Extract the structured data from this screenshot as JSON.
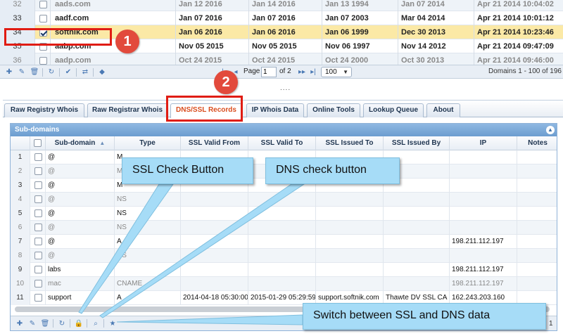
{
  "top_grid": {
    "rows": [
      {
        "num": "32",
        "checked": false,
        "domain": "aads.com",
        "d1": "Jan 12 2016",
        "d2": "Jan 14 2016",
        "d3": "Jan 13 1994",
        "d4": "Jan 07 2014",
        "d5": "Apr 21 2014 10:04:02",
        "style": "faded"
      },
      {
        "num": "33",
        "checked": false,
        "domain": "aadf.com",
        "d1": "Jan 07 2016",
        "d2": "Jan 07 2016",
        "d3": "Jan 07 2003",
        "d4": "Mar 04 2014",
        "d5": "Apr 21 2014 10:01:12",
        "style": "normal"
      },
      {
        "num": "34",
        "checked": true,
        "domain": "softnik.com",
        "d1": "Jan 06 2016",
        "d2": "Jan 06 2016",
        "d3": "Jan 06 1999",
        "d4": "Dec 30 2013",
        "d5": "Apr 21 2014 10:23:46",
        "style": "selected"
      },
      {
        "num": "35",
        "checked": false,
        "domain": "aabp.com",
        "d1": "Nov 05 2015",
        "d2": "Nov 05 2015",
        "d3": "Nov 06 1997",
        "d4": "Nov 14 2012",
        "d5": "Apr 21 2014 09:47:09",
        "style": "normal"
      },
      {
        "num": "36",
        "checked": false,
        "domain": "aadp.com",
        "d1": "Oct 24 2015",
        "d2": "Oct 24 2015",
        "d3": "Oct 24 2000",
        "d4": "Oct 30 2013",
        "d5": "Apr 21 2014 09:46:00",
        "style": "faded"
      }
    ]
  },
  "top_toolbar": {
    "page_label": "Page",
    "page_value": "1",
    "page_of": "of 2",
    "page_size": "100",
    "records": "Domains 1 - 100 of 196"
  },
  "splitter_grip": "....",
  "tabs": [
    {
      "label": "Raw Registry Whois",
      "active": false
    },
    {
      "label": "Raw Registrar Whois",
      "active": false
    },
    {
      "label": "DNS/SSL Records",
      "active": true
    },
    {
      "label": "IP Whois Data",
      "active": false
    },
    {
      "label": "Online Tools",
      "active": false
    },
    {
      "label": "Lookup Queue",
      "active": false
    },
    {
      "label": "About",
      "active": false
    }
  ],
  "subdomains": {
    "title": "Sub-domains",
    "headers": {
      "subdomain": "Sub-domain",
      "type": "Type",
      "ssl_from": "SSL Valid From",
      "ssl_to": "SSL Valid To",
      "issued_to": "SSL Issued To",
      "issued_by": "SSL Issued By",
      "ip": "IP",
      "notes": "Notes"
    },
    "rows": [
      {
        "n": "1",
        "sub": "@",
        "type": "M",
        "from": "",
        "to": "",
        "issued_to": "",
        "issued_by": "",
        "ip": "",
        "faded": false
      },
      {
        "n": "2",
        "sub": "@",
        "type": "M",
        "from": "",
        "to": "",
        "issued_to": "",
        "issued_by": "",
        "ip": "",
        "faded": true
      },
      {
        "n": "3",
        "sub": "@",
        "type": "M",
        "from": "",
        "to": "",
        "issued_to": "",
        "issued_by": "",
        "ip": "",
        "faded": false
      },
      {
        "n": "4",
        "sub": "@",
        "type": "NS",
        "from": "",
        "to": "",
        "issued_to": "",
        "issued_by": "",
        "ip": "",
        "faded": true
      },
      {
        "n": "5",
        "sub": "@",
        "type": "NS",
        "from": "",
        "to": "",
        "issued_to": "",
        "issued_by": "",
        "ip": "",
        "faded": false
      },
      {
        "n": "6",
        "sub": "@",
        "type": "NS",
        "from": "",
        "to": "",
        "issued_to": "",
        "issued_by": "",
        "ip": "",
        "faded": true
      },
      {
        "n": "7",
        "sub": "@",
        "type": "A",
        "from": "",
        "to": "",
        "issued_to": "",
        "issued_by": "",
        "ip": "198.211.112.197",
        "faded": false
      },
      {
        "n": "8",
        "sub": "@",
        "type": "NS",
        "from": "",
        "to": "",
        "issued_to": "",
        "issued_by": "",
        "ip": "",
        "faded": true
      },
      {
        "n": "9",
        "sub": "labs",
        "type": "",
        "from": "",
        "to": "",
        "issued_to": "",
        "issued_by": "",
        "ip": "198.211.112.197",
        "faded": false
      },
      {
        "n": "10",
        "sub": "mac",
        "type": "CNAME",
        "from": "",
        "to": "",
        "issued_to": "",
        "issued_by": "",
        "ip": "198.211.112.197",
        "faded": true
      },
      {
        "n": "11",
        "sub": "support",
        "type": "A",
        "from": "2014-04-18 05:30:00",
        "to": "2015-01-29 05:29:59",
        "issued_to": "support.softnik.com",
        "issued_by": "Thawte DV SSL CA",
        "ip": "162.243.203.160",
        "faded": false
      }
    ],
    "pager_tail": "1"
  },
  "annotations": {
    "badge_1": "1",
    "badge_2": "2",
    "callout_ssl": "SSL Check Button",
    "callout_dns": "DNS check button",
    "callout_switch": "Switch between SSL and DNS data"
  },
  "colors": {
    "selected_row": "#fbe9a6",
    "active_tab_text": "#d94d1e",
    "highlight_box": "#e01c13",
    "callout_bg": "#a6dcf7",
    "panel_title": "#6c9dd0"
  },
  "icons": {
    "top_toolbar": [
      "add-icon",
      "edit-icon",
      "delete-icon",
      "refresh-icon",
      "check-icon",
      "swap-icon",
      "tag-icon"
    ],
    "sub_toolbar": [
      "add-icon",
      "edit-icon",
      "delete-icon",
      "refresh-icon",
      "lock-icon",
      "search-icon",
      "star-icon"
    ]
  }
}
